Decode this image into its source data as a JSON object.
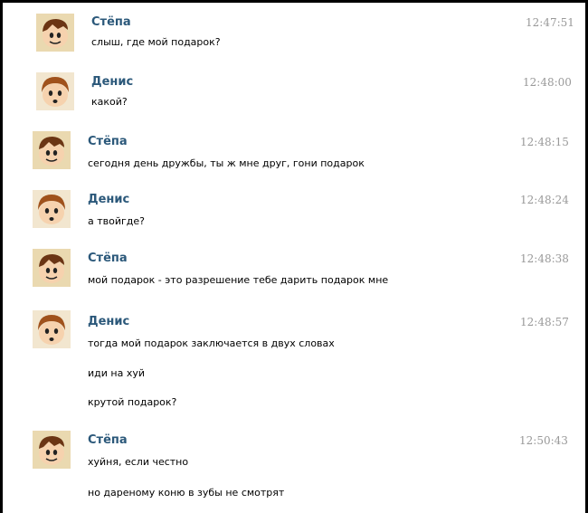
{
  "messages": [
    {
      "author": "Стёпа",
      "avatar": "stepa-avatar",
      "time": "12:47:51",
      "lines": [
        "слыш, где мой подарок?"
      ]
    },
    {
      "author": "Денис",
      "avatar": "denis-avatar",
      "time": "12:48:00",
      "lines": [
        "какой?"
      ]
    },
    {
      "author": "Стёпа",
      "avatar": "stepa-avatar",
      "time": "12:48:15",
      "lines": [
        "сегодня день дружбы, ты ж мне друг, гони подарок"
      ]
    },
    {
      "author": "Денис",
      "avatar": "denis-avatar",
      "time": "12:48:24",
      "lines": [
        "а твойгде?"
      ]
    },
    {
      "author": "Стёпа",
      "avatar": "stepa-avatar",
      "time": "12:48:38",
      "lines": [
        "мой подарок - это разрешение тебе дарить подарок мне"
      ]
    },
    {
      "author": "Денис",
      "avatar": "denis-avatar",
      "time": "12:48:57",
      "lines": [
        "тогда мой подарок заключается в двух словах",
        "иди на хуй",
        "крутой подарок?"
      ]
    },
    {
      "author": "Стёпа",
      "avatar": "stepa-avatar",
      "time": "12:50:43",
      "lines": [
        "хуйня, если честно",
        "но дареному коню в зубы не смотрят"
      ]
    }
  ],
  "colors": {
    "author": "#2b587a",
    "time": "#999999",
    "text": "#000000",
    "frame": "#000000"
  }
}
